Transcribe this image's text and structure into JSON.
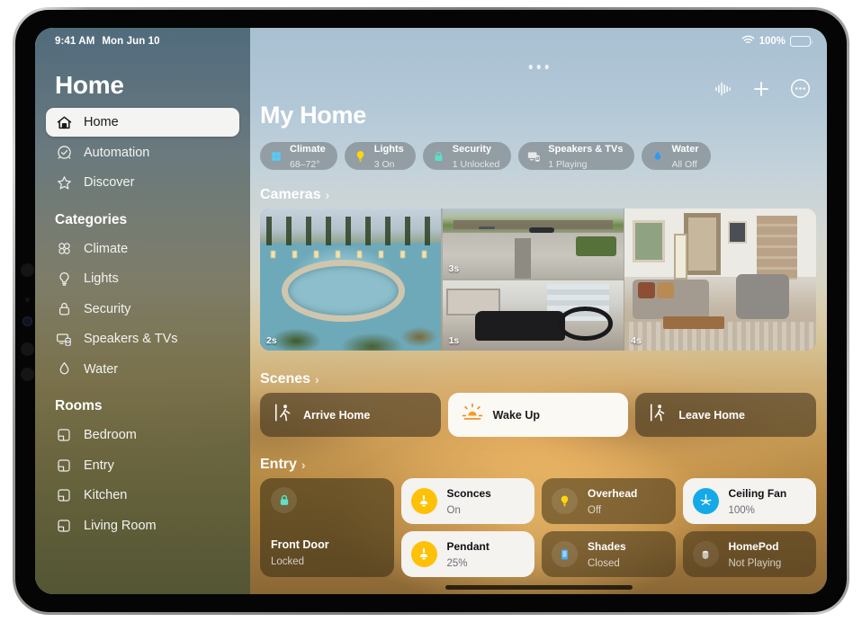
{
  "status_bar": {
    "time": "9:41 AM",
    "date": "Mon Jun 10",
    "battery_percent": "100%",
    "wifi_icon": "wifi-icon",
    "battery_icon": "battery-icon"
  },
  "sidebar": {
    "title": "Home",
    "nav": [
      {
        "label": "Home",
        "icon": "house-icon",
        "selected": true
      },
      {
        "label": "Automation",
        "icon": "clock-check-icon",
        "selected": false
      },
      {
        "label": "Discover",
        "icon": "star-icon",
        "selected": false
      }
    ],
    "categories_header": "Categories",
    "categories": [
      {
        "label": "Climate",
        "icon": "fan-icon"
      },
      {
        "label": "Lights",
        "icon": "lightbulb-icon"
      },
      {
        "label": "Security",
        "icon": "lock-icon"
      },
      {
        "label": "Speakers & TVs",
        "icon": "speaker-tv-icon"
      },
      {
        "label": "Water",
        "icon": "water-drop-icon"
      }
    ],
    "rooms_header": "Rooms",
    "rooms": [
      {
        "label": "Bedroom",
        "icon": "room-icon"
      },
      {
        "label": "Entry",
        "icon": "room-icon"
      },
      {
        "label": "Kitchen",
        "icon": "room-icon"
      },
      {
        "label": "Living Room",
        "icon": "room-icon"
      }
    ]
  },
  "main": {
    "title": "My Home",
    "toolbar": [
      {
        "name": "audio-waveform-icon"
      },
      {
        "name": "plus-icon"
      },
      {
        "name": "more-ellipsis-icon"
      }
    ],
    "status_pills": [
      {
        "title": "Climate",
        "value": "68–72°",
        "icon": "fan-icon",
        "icon_color": "#5ac8f5"
      },
      {
        "title": "Lights",
        "value": "3 On",
        "icon": "lightbulb-icon",
        "icon_color": "#ffd60a"
      },
      {
        "title": "Security",
        "value": "1 Unlocked",
        "icon": "lock-icon",
        "icon_color": "#5de0c8"
      },
      {
        "title": "Speakers & TVs",
        "value": "1 Playing",
        "icon": "speaker-tv-icon",
        "icon_color": "#e8e8ea"
      },
      {
        "title": "Water",
        "value": "All Off",
        "icon": "water-drop-icon",
        "icon_color": "#2f9bf0"
      }
    ],
    "cameras": {
      "header": "Cameras",
      "chevron": "›",
      "feeds": [
        {
          "name": "Pool",
          "timestamp": "2s"
        },
        {
          "name": "Driveway",
          "timestamp": "3s"
        },
        {
          "name": "Garage",
          "timestamp": "1s"
        },
        {
          "name": "Living Room",
          "timestamp": "4s"
        }
      ]
    },
    "scenes": {
      "header": "Scenes",
      "chevron": "›",
      "items": [
        {
          "label": "Arrive Home",
          "icon": "person-arrive-icon",
          "active": false
        },
        {
          "label": "Wake Up",
          "icon": "sunrise-icon",
          "active": true
        },
        {
          "label": "Leave Home",
          "icon": "person-leave-icon",
          "active": false
        }
      ]
    },
    "entry": {
      "header": "Entry",
      "chevron": "›",
      "accessories": [
        {
          "name": "Front Door",
          "state": "Locked",
          "icon": "lock-icon",
          "on": false,
          "icon_color": "#5de0c8"
        },
        {
          "name": "Sconces",
          "state": "On",
          "icon": "sconce-lamp-icon",
          "on": true,
          "icon_color": "#ffc107"
        },
        {
          "name": "Overhead",
          "state": "Off",
          "icon": "lightbulb-icon",
          "on": false,
          "icon_color": "#ffd60a"
        },
        {
          "name": "Ceiling Fan",
          "state": "100%",
          "icon": "ceiling-fan-icon",
          "on": true,
          "icon_color": "#16a9e8"
        },
        {
          "name": "Pendant",
          "state": "25%",
          "icon": "sconce-lamp-icon",
          "on": true,
          "icon_color": "#ffc107"
        },
        {
          "name": "Shades",
          "state": "Closed",
          "icon": "shade-blind-icon",
          "on": false,
          "icon_color": "#4aa8f0"
        },
        {
          "name": "HomePod",
          "state": "Not Playing",
          "icon": "homepod-icon",
          "on": false,
          "icon_color": "#c9c3b9"
        }
      ]
    }
  }
}
